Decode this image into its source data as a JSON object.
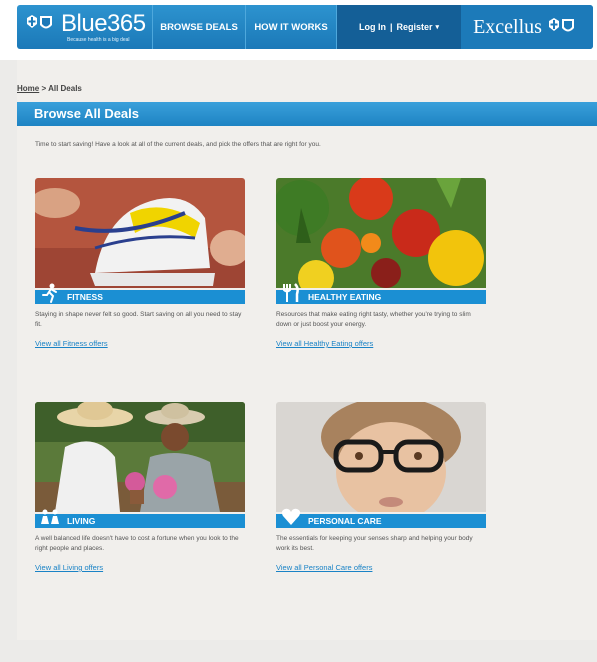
{
  "header": {
    "brand": "Blue365",
    "tagline": "Because health is a big deal",
    "nav_browse": "BROWSE DEALS",
    "nav_how": "HOW IT WORKS",
    "login": "Log In",
    "register": "Register",
    "partner": "Excellus"
  },
  "breadcrumb": {
    "home": "Home",
    "current": "All Deals"
  },
  "page_title": "Browse All Deals",
  "intro": "Time to start saving! Have a look at all of the current deals, and pick the offers that are right for you.",
  "categories": [
    {
      "label": "FITNESS",
      "desc": "Staying in shape never felt so good. Start saving on all you need to stay fit.",
      "link": "View all Fitness offers"
    },
    {
      "label": "HEALTHY EATING",
      "desc": "Resources that make eating right tasty, whether you're trying to slim down or just boost your energy.",
      "link": "View all Healthy Eating offers"
    },
    {
      "label": "LIVING",
      "desc": "A well balanced life doesn't have to cost a fortune when you look to the right people and places.",
      "link": "View all Living offers"
    },
    {
      "label": "PERSONAL CARE",
      "desc": "The essentials for keeping your senses sharp and helping your body work its best.",
      "link": "View all Personal Care offers"
    }
  ],
  "colors": {
    "accent": "#1b8fd3",
    "nav_dark": "#145f97",
    "link": "#1a83c6"
  }
}
